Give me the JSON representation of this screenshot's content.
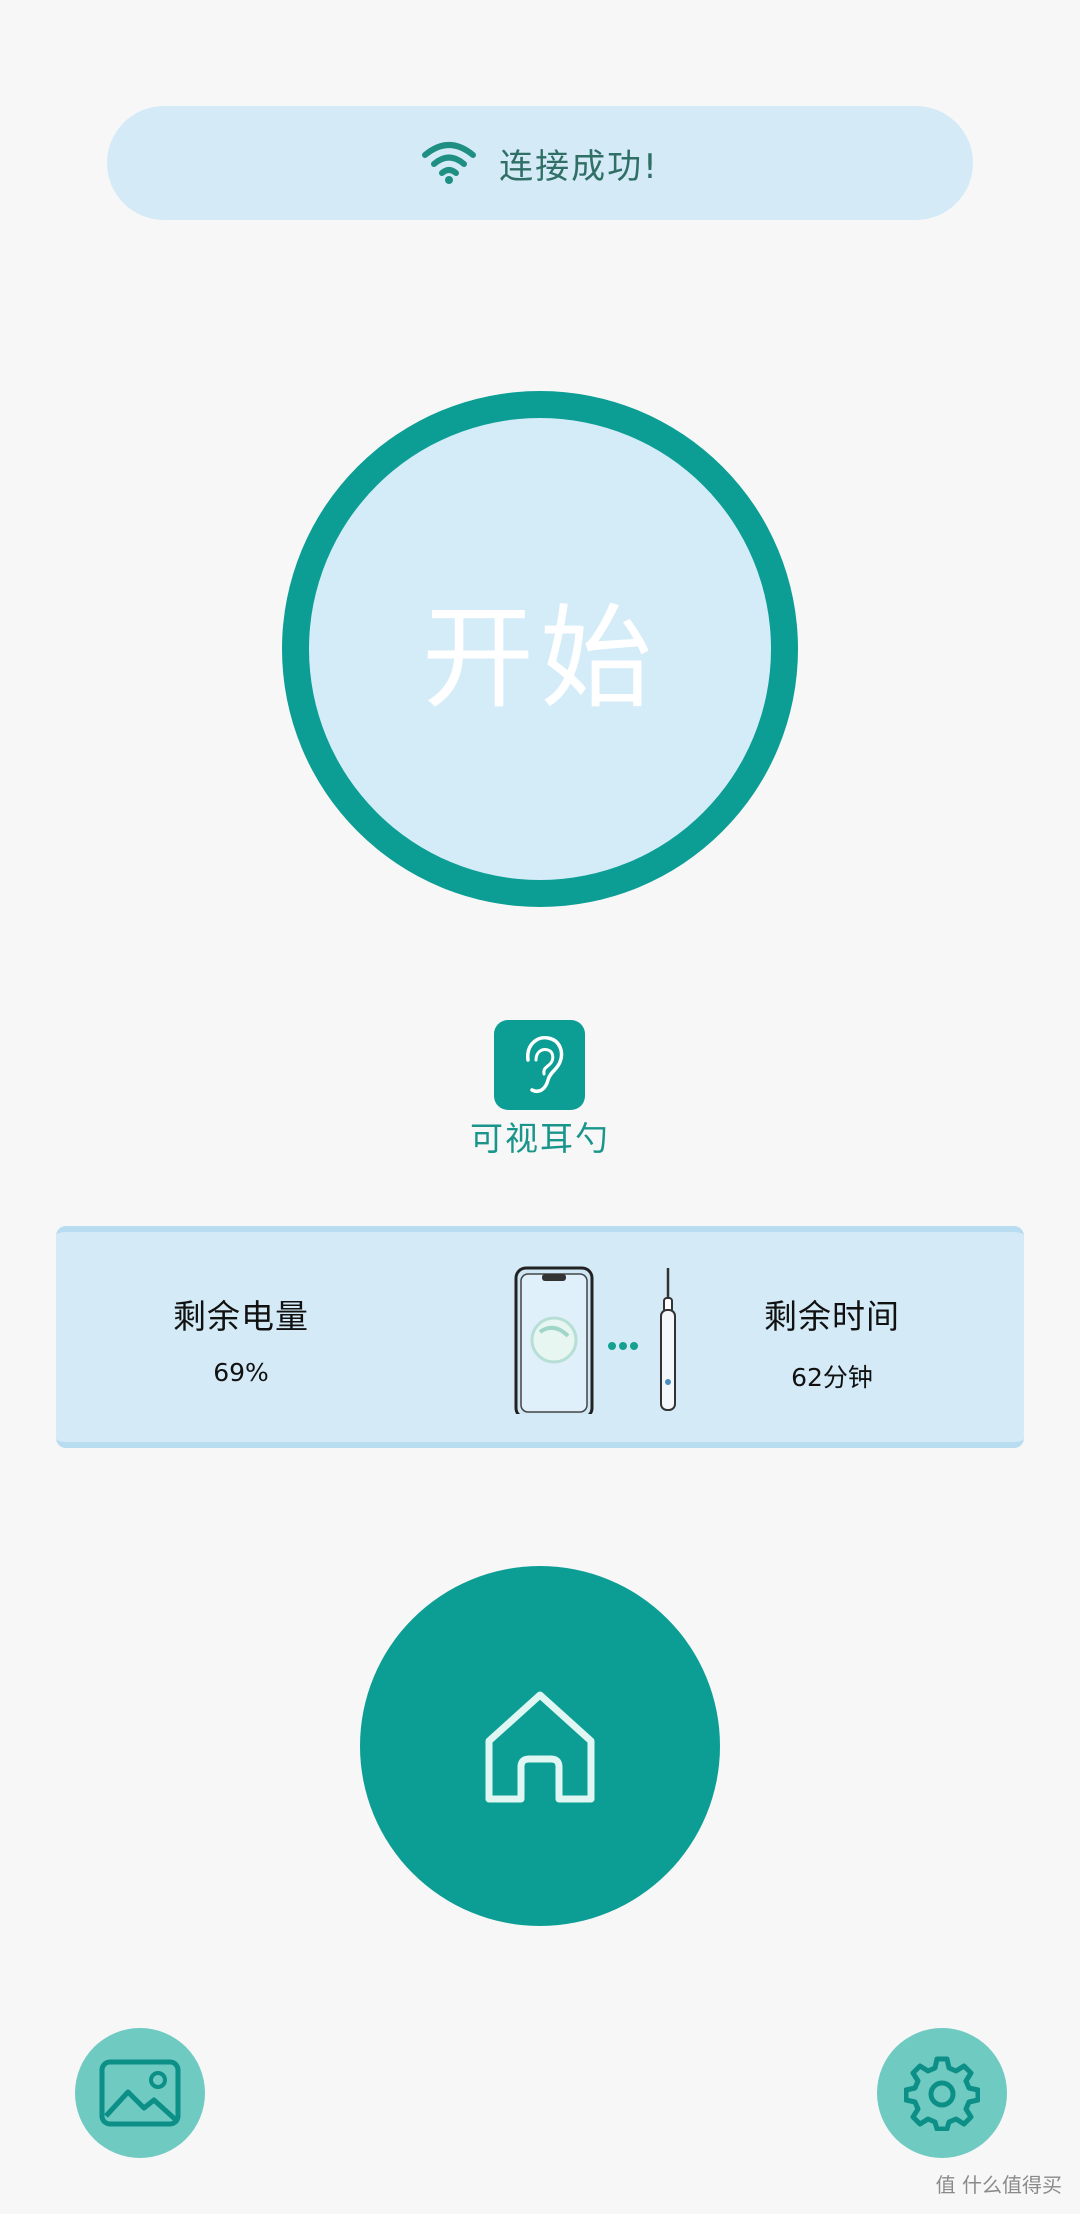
{
  "connection": {
    "status_text": "连接成功!",
    "icon": "wifi-icon"
  },
  "start_button": {
    "label": "开始"
  },
  "device": {
    "icon": "ear-icon",
    "name": "可视耳勺"
  },
  "info_card": {
    "battery_label": "剩余电量",
    "battery_value": "69%",
    "time_label": "剩余时间",
    "time_value": "62分钟",
    "illustration": [
      "phone-icon",
      "connection-dots-icon",
      "ear-pick-device-icon"
    ]
  },
  "nav": {
    "home_icon": "home-icon",
    "gallery_icon": "gallery-icon",
    "settings_icon": "settings-gear-icon"
  },
  "watermark": {
    "text": "值 什么值得买"
  },
  "colors": {
    "accent": "#0c9e94",
    "accent_light": "#6fcac2",
    "panel": "#d4eaf7",
    "background": "#f7f7f7"
  }
}
